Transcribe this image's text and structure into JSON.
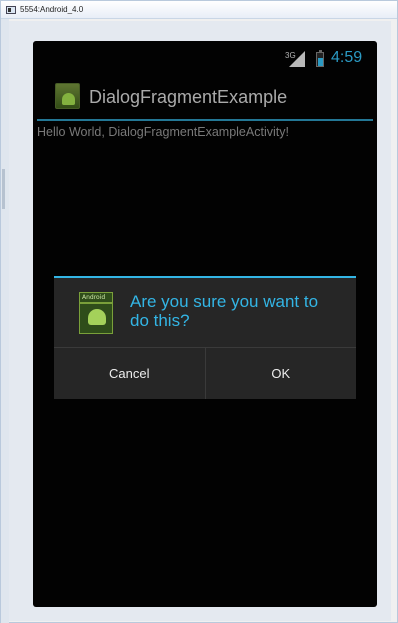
{
  "host": {
    "window_title": "5554:Android_4.0"
  },
  "status_bar": {
    "network": "3G",
    "time": "4:59",
    "icons": [
      "signal-icon",
      "battery-icon"
    ]
  },
  "action_bar": {
    "title": "DialogFragmentExample",
    "icon": "android-app-icon"
  },
  "content": {
    "text": "Hello World, DialogFragmentExampleActivity!"
  },
  "dialog": {
    "icon_label": "Android",
    "title": "Are you sure you want to do this?",
    "buttons": {
      "cancel": "Cancel",
      "ok": "OK"
    }
  },
  "colors": {
    "accent": "#33b5e5",
    "screen_background": "#030303",
    "dialog_background": "#262626"
  }
}
